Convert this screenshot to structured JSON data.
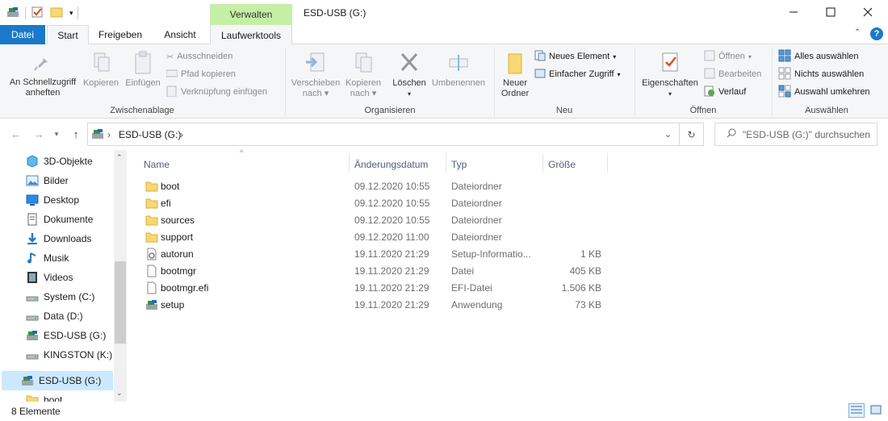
{
  "titlebar": {
    "context_tab": "Verwalten",
    "window_title": "ESD-USB (G:)"
  },
  "tabs": {
    "file": "Datei",
    "start": "Start",
    "share": "Freigeben",
    "view": "Ansicht",
    "drive_tools": "Laufwerktools"
  },
  "ribbon": {
    "clipboard": {
      "pin": "An Schnellzugriff anheften",
      "copy": "Kopieren",
      "paste": "Einfügen",
      "cut": "Ausschneiden",
      "copy_path": "Pfad kopieren",
      "paste_shortcut": "Verknüpfung einfügen",
      "label": "Zwischenablage"
    },
    "organize": {
      "move": "Verschieben nach",
      "copy_to": "Kopieren nach",
      "delete": "Löschen",
      "rename": "Umbenennen",
      "label": "Organisieren"
    },
    "new": {
      "new_folder": "Neuer Ordner",
      "new_item": "Neues Element",
      "easy_access": "Einfacher Zugriff",
      "label": "Neu"
    },
    "open": {
      "properties": "Eigenschaften",
      "open": "Öffnen",
      "edit": "Bearbeiten",
      "history": "Verlauf",
      "label": "Öffnen"
    },
    "select": {
      "select_all": "Alles auswählen",
      "select_none": "Nichts auswählen",
      "invert": "Auswahl umkehren",
      "label": "Auswählen"
    }
  },
  "address": {
    "path": "ESD-USB (G:)",
    "search_placeholder": "\"ESD-USB (G:)\" durchsuchen"
  },
  "nav": {
    "items": [
      {
        "label": "3D-Objekte",
        "icon": "cube-icon"
      },
      {
        "label": "Bilder",
        "icon": "pictures-icon"
      },
      {
        "label": "Desktop",
        "icon": "desktop-icon"
      },
      {
        "label": "Dokumente",
        "icon": "documents-icon"
      },
      {
        "label": "Downloads",
        "icon": "downloads-icon"
      },
      {
        "label": "Musik",
        "icon": "music-icon"
      },
      {
        "label": "Videos",
        "icon": "videos-icon"
      },
      {
        "label": "System (C:)",
        "icon": "drive-icon"
      },
      {
        "label": "Data (D:)",
        "icon": "drive-icon"
      },
      {
        "label": "ESD-USB (G:)",
        "icon": "usb-drive-icon"
      },
      {
        "label": "KINGSTON (K:)",
        "icon": "drive-icon"
      },
      {
        "label": "ESD-USB (G:)",
        "icon": "usb-drive-icon"
      },
      {
        "label": "boot",
        "icon": "folder-icon"
      }
    ]
  },
  "columns": {
    "name": "Name",
    "date": "Änderungsdatum",
    "type": "Typ",
    "size": "Größe"
  },
  "files": [
    {
      "name": "boot",
      "date": "09.12.2020 10:55",
      "type": "Dateiordner",
      "size": "",
      "icon": "folder-icon"
    },
    {
      "name": "efi",
      "date": "09.12.2020 10:55",
      "type": "Dateiordner",
      "size": "",
      "icon": "folder-icon"
    },
    {
      "name": "sources",
      "date": "09.12.2020 10:55",
      "type": "Dateiordner",
      "size": "",
      "icon": "folder-icon"
    },
    {
      "name": "support",
      "date": "09.12.2020 11:00",
      "type": "Dateiordner",
      "size": "",
      "icon": "folder-icon"
    },
    {
      "name": "autorun",
      "date": "19.11.2020 21:29",
      "type": "Setup-Informatio...",
      "size": "1 KB",
      "icon": "setup-info-icon"
    },
    {
      "name": "bootmgr",
      "date": "19.11.2020 21:29",
      "type": "Datei",
      "size": "405 KB",
      "icon": "file-icon"
    },
    {
      "name": "bootmgr.efi",
      "date": "19.11.2020 21:29",
      "type": "EFI-Datei",
      "size": "1.506 KB",
      "icon": "file-icon"
    },
    {
      "name": "setup",
      "date": "19.11.2020 21:29",
      "type": "Anwendung",
      "size": "73 KB",
      "icon": "setup-app-icon"
    }
  ],
  "status": {
    "count": "8 Elemente"
  },
  "colors": {
    "file_tab": "#1979ca",
    "context_tab": "#c6efa6",
    "selection": "#cce8ff",
    "folder": "#f8d775"
  }
}
